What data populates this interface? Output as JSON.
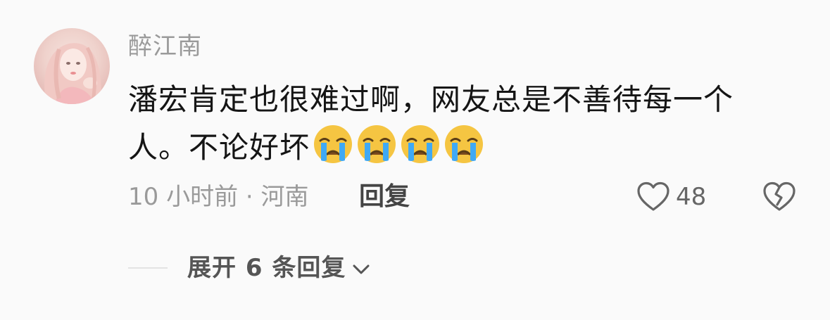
{
  "comment": {
    "username": "醉江南",
    "content_line1": "潘宏肯定也很难过啊，网友总是不善待每一个",
    "content_line2": "人。不论好坏",
    "emojis": [
      "crying-face",
      "crying-face",
      "crying-face",
      "crying-face"
    ],
    "meta": "10 小时前 · 河南",
    "reply_label": "回复",
    "like_count": "48"
  },
  "expand": {
    "label": "展开 6 条回复"
  },
  "colors": {
    "background": "#fafafa",
    "secondary_text": "#9a9a9a",
    "primary_text": "#151515",
    "emoji_face": "#f5c542",
    "emoji_tear": "#3fa9f5"
  }
}
